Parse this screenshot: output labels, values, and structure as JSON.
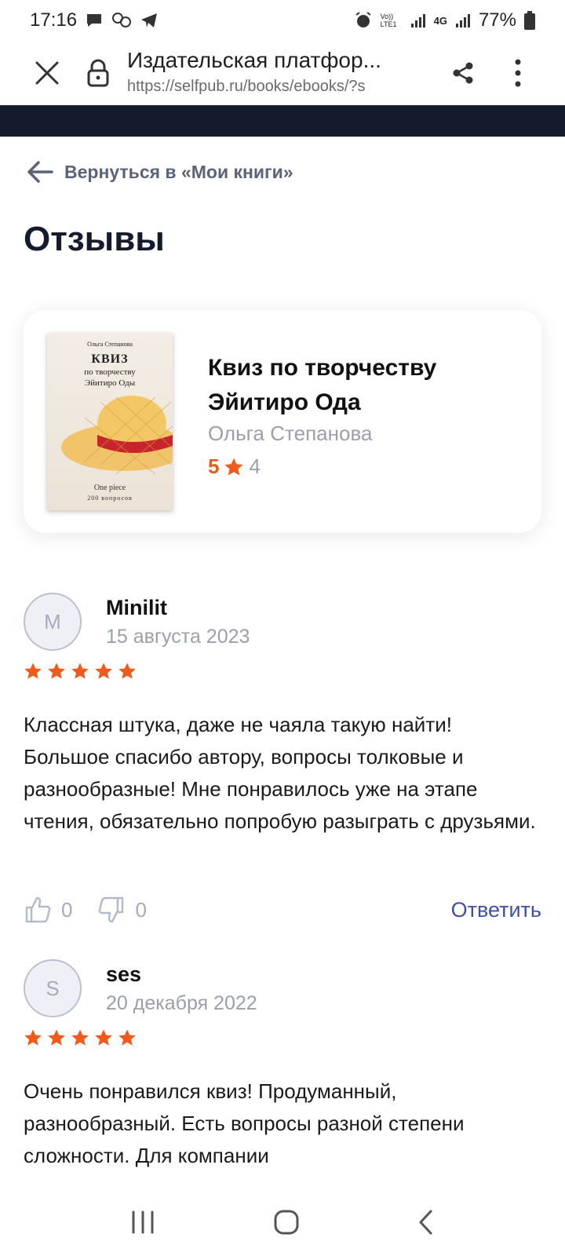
{
  "status_bar": {
    "time": "17:16",
    "battery": "77%",
    "network": "4G",
    "volte": "Vo)) LTE1"
  },
  "browser": {
    "page_title": "Издательская платфор...",
    "url": "https://selfpub.ru/books/ebooks/?s"
  },
  "back_link": "Вернуться в «Мои книги»",
  "page_title": "Отзывы",
  "book": {
    "title": "Квиз по творчеству Эйитиро Ода",
    "author": "Ольга Степанова",
    "rating": "5",
    "rating_count": "4",
    "cover": {
      "author": "Ольга Степанова",
      "title_1": "КВИЗ",
      "title_2": "по творчеству",
      "title_3": "Эйитиро Оды",
      "bottom_1": "One piece",
      "bottom_2": "200 вопросов"
    }
  },
  "reviews": [
    {
      "initial": "M",
      "name": "Minilit",
      "date": "15 августа 2023",
      "stars": 5,
      "text": "Классная штука, даже не чаяла такую найти! Большое спасибо автору, вопросы толковые и разнообразные! Мне понравилось уже на этапе чтения, обязательно попробую разыграть с друзьями.",
      "likes": "0",
      "dislikes": "0",
      "reply_label": "Ответить"
    },
    {
      "initial": "S",
      "name": "ses",
      "date": "20 декабря 2022",
      "stars": 5,
      "text": "Очень понравился квиз! Продуманный, разнообразный. Есть вопросы разной степени сложности. Для компании"
    }
  ],
  "colors": {
    "accent_orange": "#f05a1a",
    "reply_blue": "#3e4fa8",
    "dark_band": "#141b2d"
  }
}
